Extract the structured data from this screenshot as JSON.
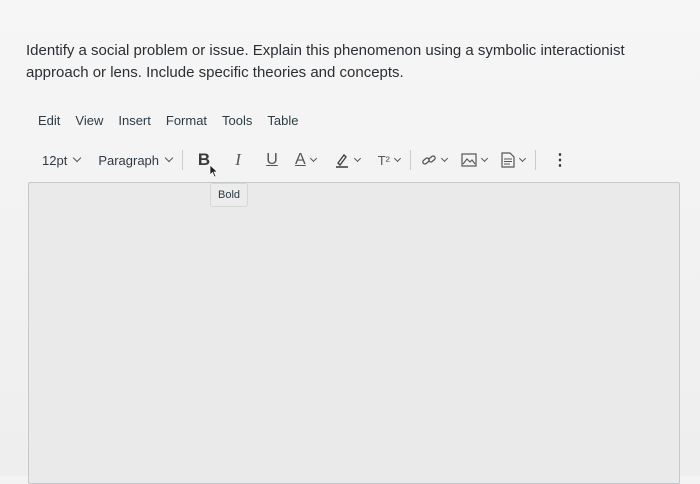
{
  "question": {
    "text": "Identify a social problem or issue. Explain this phenomenon using a symbolic interactionist approach or lens. Include specific theories and concepts."
  },
  "menubar": {
    "items": [
      "Edit",
      "View",
      "Insert",
      "Format",
      "Tools",
      "Table"
    ]
  },
  "toolbar": {
    "font_size": "12pt",
    "block_format": "Paragraph",
    "bold_label": "B",
    "italic_label": "I",
    "underline_label": "U",
    "text_color_label": "A",
    "superscript_label": "T²",
    "more_label": "⋮"
  },
  "tooltip": {
    "text": "Bold"
  },
  "colors": {
    "text": "#2d3b45",
    "border": "#c4c8cb",
    "editor_bg": "#eaeaea"
  },
  "icons": [
    "chevron-down-icon",
    "highlighter-icon",
    "link-icon",
    "image-icon",
    "document-icon",
    "more-icon"
  ]
}
